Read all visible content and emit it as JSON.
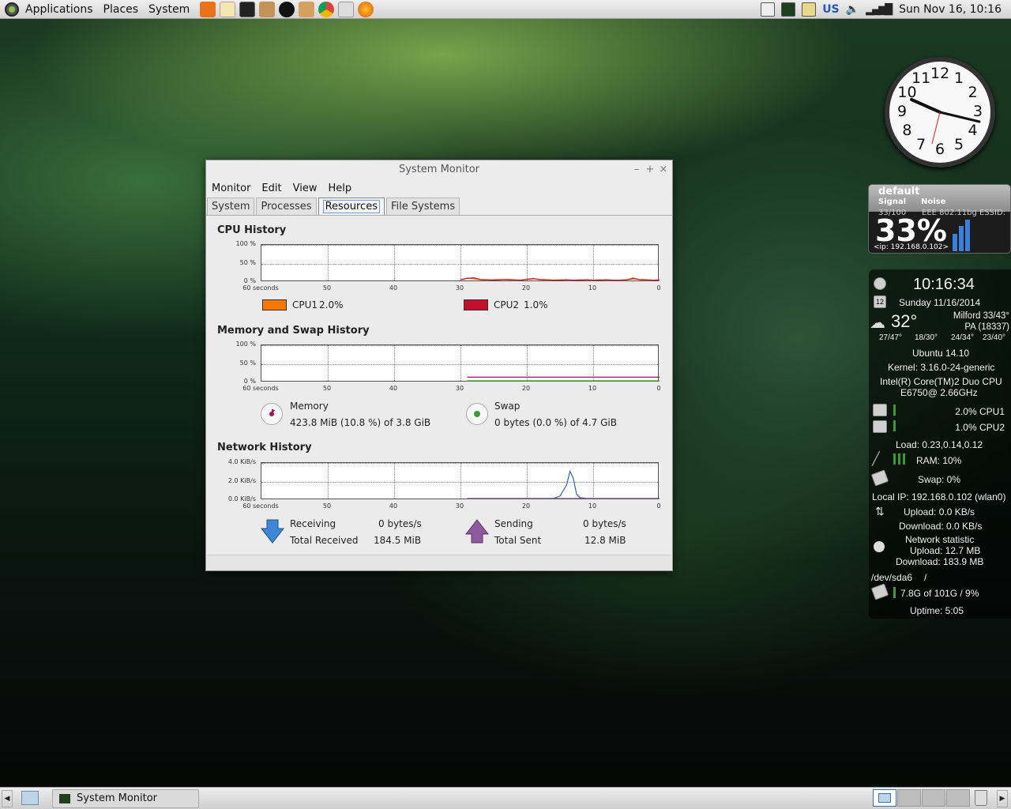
{
  "top_panel": {
    "menus": [
      "Applications",
      "Places",
      "System"
    ],
    "keyboard": "US",
    "clock": "Sun Nov 16, 10:16"
  },
  "analog_clock": {
    "numbers": [
      "12",
      "1",
      "2",
      "3",
      "4",
      "5",
      "6",
      "7",
      "8",
      "9",
      "10",
      "11"
    ]
  },
  "wifi_widget": {
    "profile": "default",
    "signal_label": "Signal",
    "noise_label": "Noise",
    "signal_value": "33/100",
    "standard": "EEE 802.11bg  ESSID:",
    "percent": "33%",
    "ip": "<ip: 192.168.0.102>",
    "signal_level": 0.33
  },
  "conky": {
    "time": "10:16:34",
    "date": "Sunday 11/16/2014",
    "calendar_day": "12",
    "temp": "32°",
    "location": "Milford 33/43°",
    "location2": "PA (18337)",
    "forecast": [
      "27/47°",
      "18/30°",
      "24/34°",
      "23/40°"
    ],
    "os": "Ubuntu 14.10",
    "kernel": "Kernel: 3.16.0-24-generic",
    "cpu_model": "Intel(R) Core(TM)2 Duo CPU",
    "cpu_model2": "E6750@ 2.66GHz",
    "cpu1": "2.0% CPU1",
    "cpu2": "1.0% CPU2",
    "load": "Load: 0.23,0.14,0.12",
    "ram": "RAM: 10%",
    "swap": "Swap: 0%",
    "local_ip": "Local IP: 192.168.0.102 (wlan0)",
    "upload": "Upload: 0.0 KB/s",
    "download": "Download: 0.0 KB/s",
    "net_stat": "Network statistic",
    "total_up": "Upload: 12.7 MB",
    "total_down": "Download: 183.9 MB",
    "disk": "/dev/sda6",
    "disk_mount": "/",
    "disk_usage": "7.8G of 101G / 9%",
    "uptime": "Uptime: 5:05"
  },
  "window": {
    "title": "System Monitor",
    "controls": [
      "–",
      "+",
      "×"
    ],
    "menu": [
      "Monitor",
      "Edit",
      "View",
      "Help"
    ],
    "tabs": [
      "System",
      "Processes",
      "Resources",
      "File Systems"
    ],
    "active_tab": "Resources",
    "cpu": {
      "title": "CPU History",
      "cpu1_label": "CPU1",
      "cpu1_value": "2.0%",
      "cpu2_label": "CPU2",
      "cpu2_value": "1.0%",
      "cpu1_color": "#f57900",
      "cpu2_color": "#c4102b"
    },
    "memory": {
      "title": "Memory and Swap History",
      "mem_label": "Memory",
      "mem_value": "423.8 MiB (10.8 %) of 3.8 GiB",
      "swap_label": "Swap",
      "swap_value": "0 bytes (0.0 %) of 4.7 GiB"
    },
    "network": {
      "title": "Network History",
      "receiving_label": "Receiving",
      "receiving_value": "0 bytes/s",
      "total_received_label": "Total Received",
      "total_received_value": "184.5 MiB",
      "sending_label": "Sending",
      "sending_value": "0 bytes/s",
      "total_sent_label": "Total Sent",
      "total_sent_value": "12.8 MiB"
    }
  },
  "chart_data": [
    {
      "type": "line",
      "title": "CPU History",
      "xlabel": "",
      "ylabel": "",
      "x_ticks": [
        "60 seconds",
        "50",
        "40",
        "30",
        "20",
        "10",
        "0"
      ],
      "y_ticks": [
        "100 %",
        "50 %",
        "0 %"
      ],
      "x": [
        30,
        29,
        28,
        27,
        26,
        25,
        24,
        23,
        22,
        21,
        20,
        19,
        18,
        17,
        16,
        15,
        14,
        13,
        12,
        11,
        10,
        9,
        8,
        7,
        6,
        5,
        4,
        3,
        2,
        1,
        0
      ],
      "series": [
        {
          "name": "CPU1",
          "color": "#f57900",
          "values": [
            2,
            7,
            5,
            2,
            1,
            2,
            3,
            2,
            1,
            1,
            4,
            6,
            2,
            1,
            1,
            2,
            1,
            1,
            2,
            1,
            1,
            2,
            1,
            1,
            1,
            1,
            8,
            2,
            1,
            1,
            2
          ]
        },
        {
          "name": "CPU2",
          "color": "#c4102b",
          "values": [
            2,
            6,
            8,
            3,
            2,
            1,
            2,
            3,
            2,
            1,
            3,
            5,
            3,
            2,
            1,
            1,
            2,
            1,
            1,
            2,
            1,
            1,
            2,
            1,
            1,
            2,
            5,
            3,
            2,
            1,
            1
          ]
        }
      ],
      "ylim": [
        0,
        100
      ]
    },
    {
      "type": "line",
      "title": "Memory and Swap History",
      "xlabel": "",
      "ylabel": "",
      "x_ticks": [
        "60 seconds",
        "50",
        "40",
        "30",
        "20",
        "10",
        "0"
      ],
      "y_ticks": [
        "100 %",
        "50 %",
        "0 %"
      ],
      "x": [
        29,
        0
      ],
      "series": [
        {
          "name": "Memory",
          "color": "#a0144f",
          "values": [
            10.8,
            10.8
          ]
        },
        {
          "name": "Swap",
          "color": "#3a9a3a",
          "values": [
            0,
            0
          ]
        }
      ],
      "ylim": [
        0,
        100
      ]
    },
    {
      "type": "line",
      "title": "Network History",
      "xlabel": "",
      "ylabel": "",
      "x_ticks": [
        "60 seconds",
        "50",
        "40",
        "30",
        "20",
        "10",
        "0"
      ],
      "y_ticks": [
        "4.0 KiB/s",
        "2.0 KiB/s",
        "0.0 KiB/s"
      ],
      "x": [
        29,
        16,
        15,
        14,
        13.5,
        13,
        12.5,
        12,
        11,
        10,
        0
      ],
      "series": [
        {
          "name": "Receiving",
          "color": "#3465a4",
          "values": [
            0,
            0,
            0.3,
            1.6,
            3.2,
            2.4,
            0.5,
            0.1,
            0,
            0,
            0
          ]
        },
        {
          "name": "Sending",
          "color": "#75507b",
          "values": [
            0,
            0,
            0,
            0,
            0,
            0,
            0,
            0,
            0,
            0,
            0
          ]
        }
      ],
      "ylim": [
        0,
        4.0
      ]
    }
  ],
  "bottom_panel": {
    "task": "System Monitor"
  }
}
